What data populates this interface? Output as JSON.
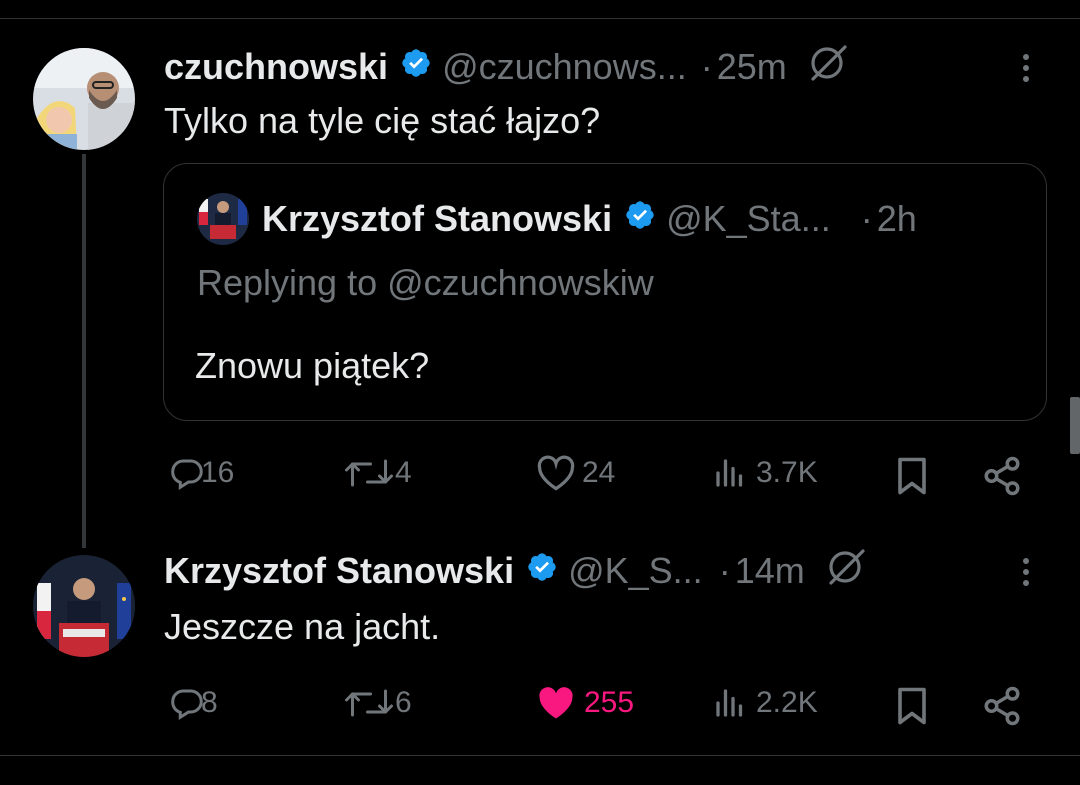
{
  "tweet1": {
    "display_name": "czuchnowski",
    "handle": "@czuchnows...",
    "separator": "·",
    "time": "25m",
    "text": "Tylko na tyle cię stać łajzo?",
    "quote": {
      "display_name": "Krzysztof Stanowski",
      "handle": "@K_Sta...",
      "separator": "·",
      "time": "2h",
      "replying_to": "Replying to @czuchnowskiw",
      "text": "Znowu piątek?"
    },
    "actions": {
      "replies": "16",
      "reposts": "4",
      "likes": "24",
      "views": "3.7K"
    }
  },
  "tweet2": {
    "display_name": "Krzysztof Stanowski",
    "handle": "@K_S...",
    "separator": "·",
    "time": "14m",
    "text": "Jeszcze na jacht.",
    "actions": {
      "replies": "8",
      "reposts": "6",
      "likes": "255",
      "views": "2.2K",
      "liked": true
    }
  },
  "colors": {
    "background": "#000000",
    "text_primary": "#e7e9ea",
    "text_secondary": "#71767b",
    "verified_blue": "#1d9bf0",
    "like_pink": "#f91880",
    "border": "#2f3336"
  }
}
